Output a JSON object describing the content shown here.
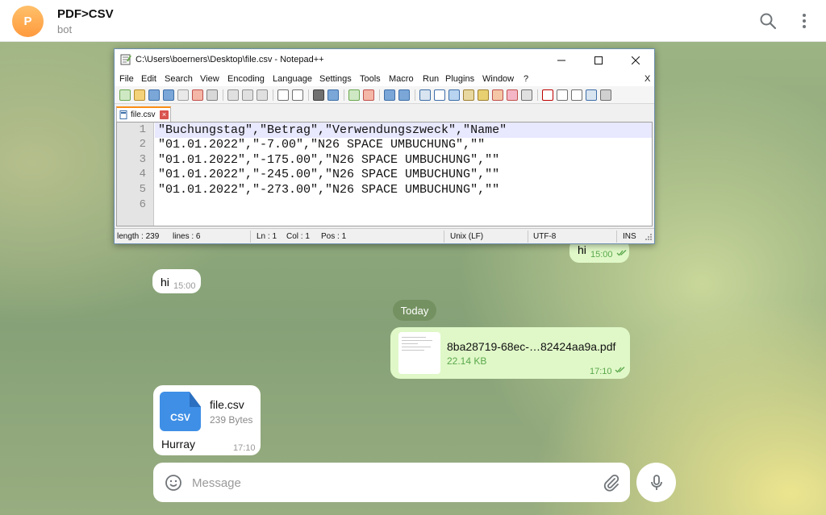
{
  "header": {
    "avatar_letter": "P",
    "chat_name": "PDF>CSV",
    "chat_subtitle": "bot"
  },
  "notepad": {
    "title": "C:\\Users\\boerners\\Desktop\\file.csv - Notepad++",
    "menu": [
      "File",
      "Edit",
      "Search",
      "View",
      "Encoding",
      "Language",
      "Settings",
      "Tools",
      "Macro",
      "Run",
      "Plugins",
      "Window",
      "?"
    ],
    "menu_close": "X",
    "tab_label": "file.csv",
    "line_numbers": [
      "1",
      "2",
      "3",
      "4",
      "5",
      "6"
    ],
    "lines": [
      "\"Buchungstag\",\"Betrag\",\"Verwendungszweck\",\"Name\"",
      "\"01.01.2022\",\"-7.00\",\"N26 SPACE UMBUCHUNG\",\"\"",
      "\"01.01.2022\",\"-175.00\",\"N26 SPACE UMBUCHUNG\",\"\"",
      "\"01.01.2022\",\"-245.00\",\"N26 SPACE UMBUCHUNG\",\"\"",
      "\"01.01.2022\",\"-273.00\",\"N26 SPACE UMBUCHUNG\",\"\"",
      ""
    ],
    "status": {
      "length": "length : 239",
      "lines": "lines : 6",
      "ln": "Ln : 1",
      "col": "Col : 1",
      "pos": "Pos : 1",
      "eol": "Unix (LF)",
      "encoding": "UTF-8",
      "mode": "INS"
    }
  },
  "messages": {
    "out_hi": {
      "text": "hi",
      "time": "15:00"
    },
    "in_hi": {
      "text": "hi",
      "time": "15:00"
    },
    "date_separator": "Today",
    "pdf": {
      "filename": "8ba28719-68ec-…82424aa9a.pdf",
      "size": "22.14 KB",
      "time": "17:10"
    },
    "csv": {
      "icon_label": "CSV",
      "filename": "file.csv",
      "size": "239 Bytes",
      "caption": "Hurray",
      "time": "17:10"
    }
  },
  "composer": {
    "placeholder": "Message"
  },
  "colors": {
    "accent_orange": "#ff9a3e",
    "bubble_out": "#e0f8c8",
    "csv_icon_blue": "#3f8fe6"
  }
}
